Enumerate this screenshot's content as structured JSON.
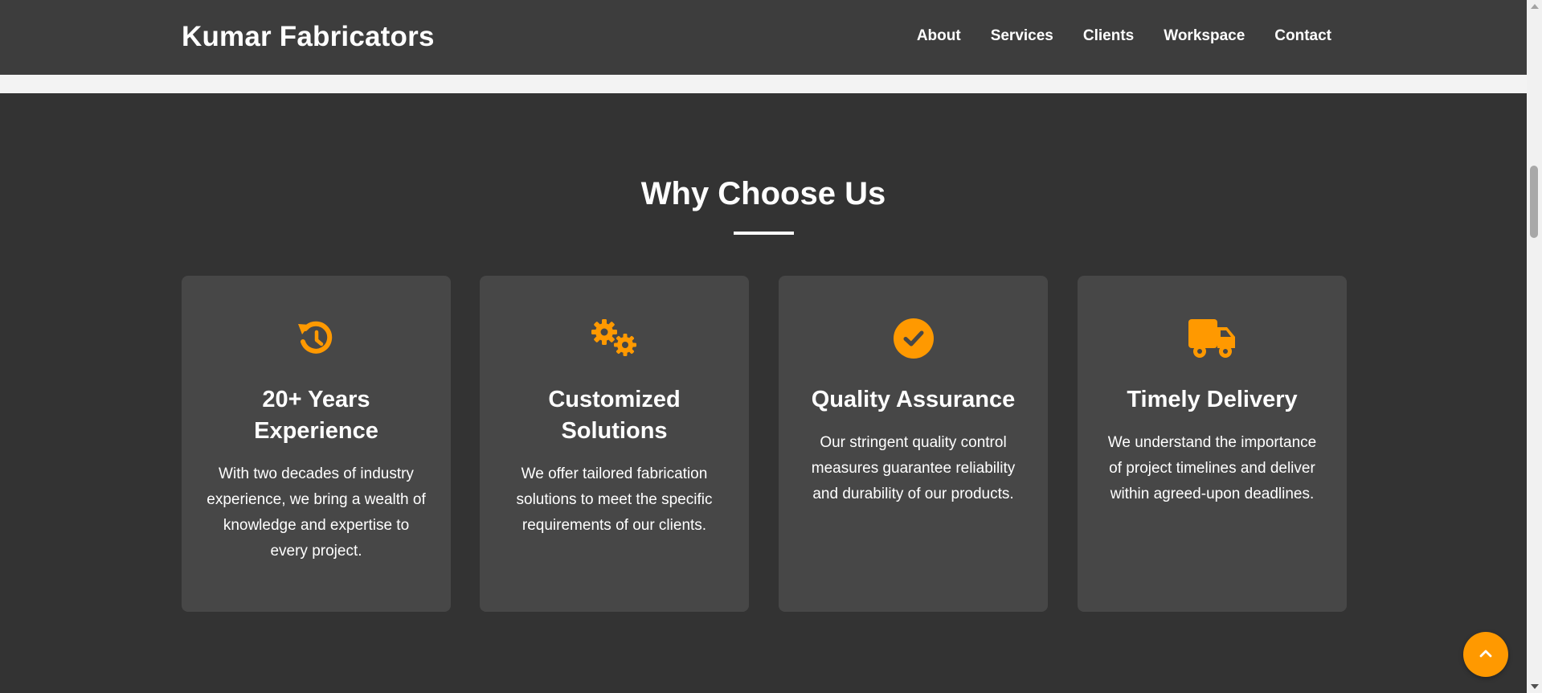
{
  "brand": "Kumar Fabricators",
  "nav": [
    "About",
    "Services",
    "Clients",
    "Workspace",
    "Contact"
  ],
  "section": {
    "title": "Why Choose Us"
  },
  "features": [
    {
      "icon": "history-icon",
      "title": "20+ Years Experience",
      "description": "With two decades of industry experience, we bring a wealth of knowledge and expertise to every project."
    },
    {
      "icon": "cogs-icon",
      "title": "Customized Solutions",
      "description": "We offer tailored fabrication solutions to meet the specific requirements of our clients."
    },
    {
      "icon": "check-circle-icon",
      "title": "Quality Assurance",
      "description": "Our stringent quality control measures guarantee reliability and durability of our products."
    },
    {
      "icon": "truck-icon",
      "title": "Timely Delivery",
      "description": "We understand the importance of project timelines and deliver within agreed-upon deadlines."
    }
  ],
  "colors": {
    "accent": "#ff9900",
    "navbar": "#3d3d3d",
    "section_bg": "#333333",
    "card_bg": "#474747"
  },
  "back_to_top_icon": "chevron-up-icon"
}
